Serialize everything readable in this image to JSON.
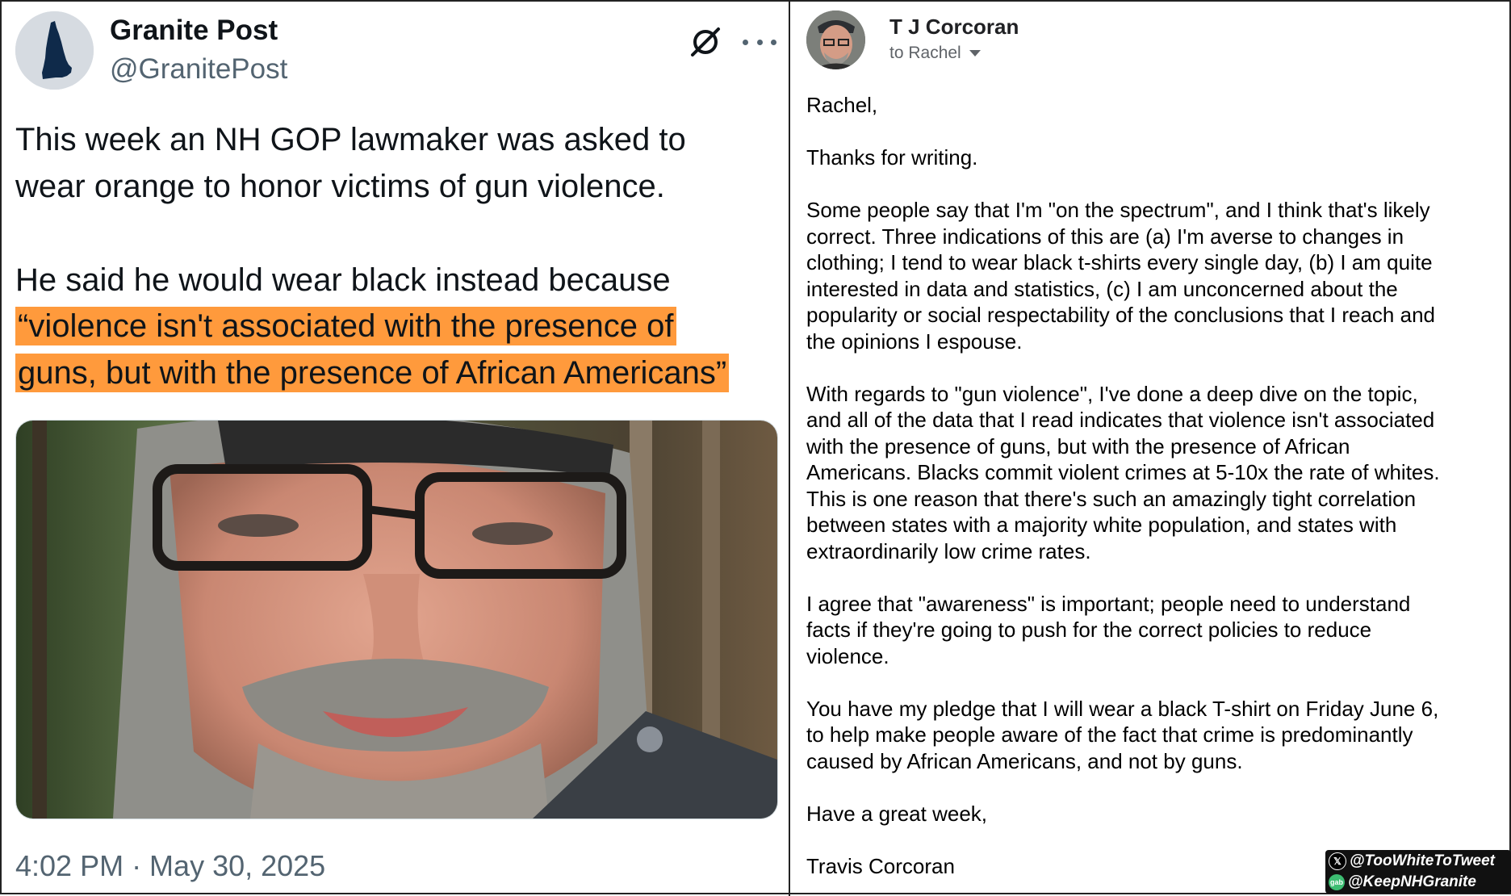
{
  "tweet": {
    "name": "Granite Post",
    "handle": "@GranitePost",
    "text_line1": "This week an NH GOP lawmaker was asked to",
    "text_line2": "wear orange to honor victims of gun violence.",
    "text_line3": "He said he would wear black instead because",
    "quote_line1": "“violence isn't associated with the presence of",
    "quote_line2": "guns, but with the presence of African Americans”",
    "timestamp": "4:02 PM · May 30, 2025",
    "colors": {
      "highlight": "#ff9a3c",
      "muted": "#536471",
      "text": "#0f1419"
    },
    "icons": {
      "grok": "grok-icon",
      "more": "more-options-icon"
    }
  },
  "email": {
    "from": "T J Corcoran",
    "to": "to Rachel",
    "lines": [
      "Rachel,",
      "",
      "Thanks for writing.",
      "",
      "Some people say that I'm \"on the spectrum\", and I think that's likely",
      "correct. Three indications of this are (a) I'm averse to changes in",
      "clothing; I tend to wear black t-shirts every single day, (b) I am quite",
      "interested in data and statistics, (c) I am unconcerned about the",
      "popularity or social respectability of the conclusions that I reach and",
      "the opinions I espouse.",
      "",
      "With regards to \"gun violence\", I've done a deep dive on the topic,",
      "and all of the data that I read indicates that violence isn't associated",
      "with the presence of guns, but with the presence of African",
      "Americans. Blacks commit violent crimes at 5-10x the rate of whites.",
      "This is one reason that there's such an amazingly tight correlation",
      "between states with a majority white population, and states with",
      "extraordinarily low crime rates.",
      "",
      "I agree that \"awareness\" is important; people need to understand",
      "facts if they're going to push for the correct policies to reduce",
      "violence.",
      "",
      "You have my pledge that I will wear a black T-shirt on Friday June 6,",
      "to help make people aware of the fact that crime is predominantly",
      "caused by African Americans, and not by guns.",
      "",
      "Have a great week,",
      "",
      "Travis Corcoran"
    ]
  },
  "watermark": {
    "line1": "@TooWhiteToTweet",
    "line2": "@KeepNHGranite",
    "icon1": "x-logo-icon",
    "icon2": "gab-logo-icon",
    "icon2_label": "gab"
  }
}
